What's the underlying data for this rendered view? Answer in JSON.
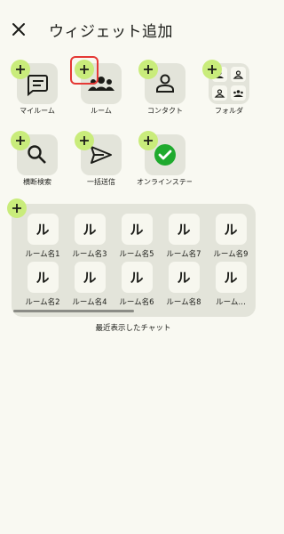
{
  "header": {
    "title": "ウィジェット追加"
  },
  "widgets": [
    {
      "label": "マイルーム",
      "icon": "chat-bubble-icon"
    },
    {
      "label": "ルーム",
      "icon": "groups-icon"
    },
    {
      "label": "コンタクト",
      "icon": "person-icon"
    },
    {
      "label": "フォルダ",
      "icon": "folder-grid-icon"
    },
    {
      "label": "横断検索",
      "icon": "search-icon"
    },
    {
      "label": "一括送信",
      "icon": "send-icon"
    },
    {
      "label": "オンラインステータス",
      "icon": "check-circle-icon"
    }
  ],
  "recent_chat": {
    "caption": "最近表示したチャット",
    "glyph": "ル",
    "rooms": [
      "ルーム名1",
      "ルーム名3",
      "ルーム名5",
      "ルーム名7",
      "ルーム名9",
      "ルーム名2",
      "ルーム名4",
      "ルーム名6",
      "ルーム名8",
      "ルーム…"
    ]
  },
  "colors": {
    "plus_badge": "#c9ec7b",
    "tile": "#e3e4da",
    "check": "#1faa2e",
    "highlight": "#e53935"
  }
}
